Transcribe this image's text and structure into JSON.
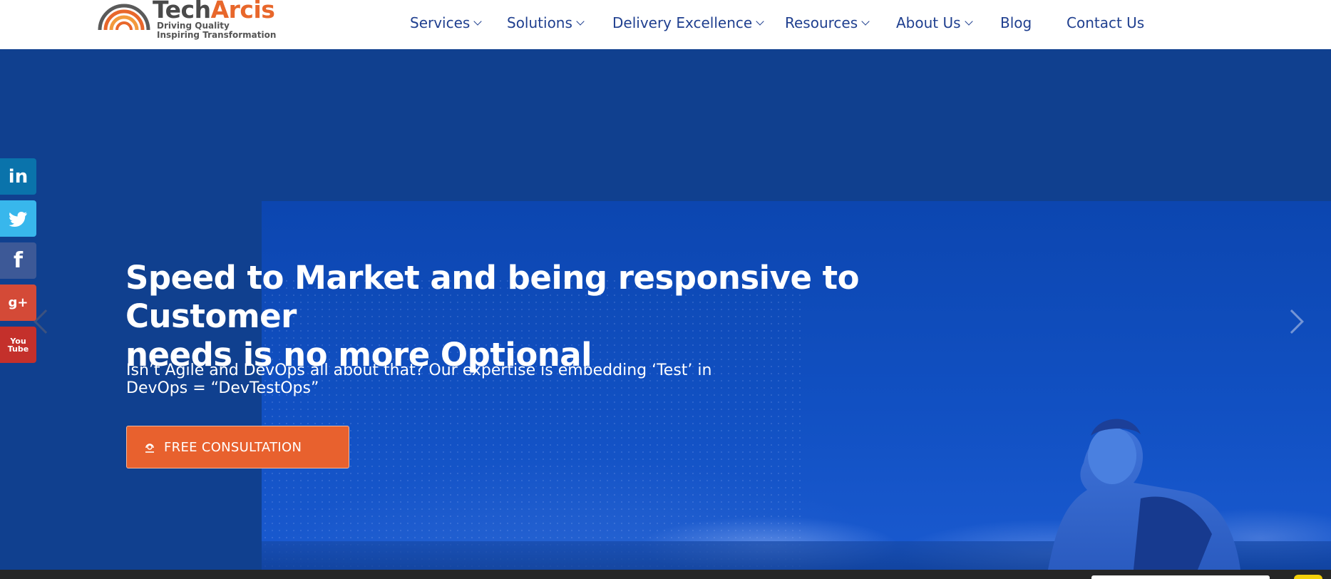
{
  "brand": {
    "name_part1": "Tech",
    "name_part2": "Arcis",
    "tagline_line1": "Driving Quality",
    "tagline_line2": "Inspiring Transformation",
    "colors": {
      "orange": "#e8672b",
      "gray": "#4a4a4a"
    }
  },
  "nav": {
    "items": [
      {
        "label": "Services",
        "has_dropdown": true
      },
      {
        "label": "Solutions",
        "has_dropdown": true
      },
      {
        "label": "Delivery Excellence",
        "has_dropdown": true
      },
      {
        "label": "Resources",
        "has_dropdown": true
      },
      {
        "label": "About Us",
        "has_dropdown": true
      },
      {
        "label": "Blog",
        "has_dropdown": false
      },
      {
        "label": "Contact Us",
        "has_dropdown": false
      }
    ]
  },
  "hero": {
    "headline_line1": "Speed to Market and being responsive to Customer",
    "headline_line2": "needs is no more Optional",
    "subhead_line1": "Isn’t Agile and DevOps all about that? Our expertise is embedding ‘Test’ in",
    "subhead_line2": "DevOps = “DevTestOps”",
    "cta_label": "FREE CONSULTATION",
    "cta_icon": "headset-icon",
    "slide_count": 5,
    "active_slide": 5,
    "colors": {
      "background": "#10408f",
      "cta": "#e8612e"
    }
  },
  "social": {
    "items": [
      {
        "name": "linkedin",
        "glyph": "in",
        "color": "#0a73ab"
      },
      {
        "name": "twitter",
        "glyph": "",
        "color": "#38b7ec"
      },
      {
        "name": "facebook",
        "glyph": "f",
        "color": "#3d5997"
      },
      {
        "name": "google-plus",
        "glyph": "g+",
        "color": "#d44a37"
      },
      {
        "name": "youtube",
        "glyph_line1": "You",
        "glyph_line2": "Tube",
        "color": "#c4302b"
      }
    ]
  }
}
